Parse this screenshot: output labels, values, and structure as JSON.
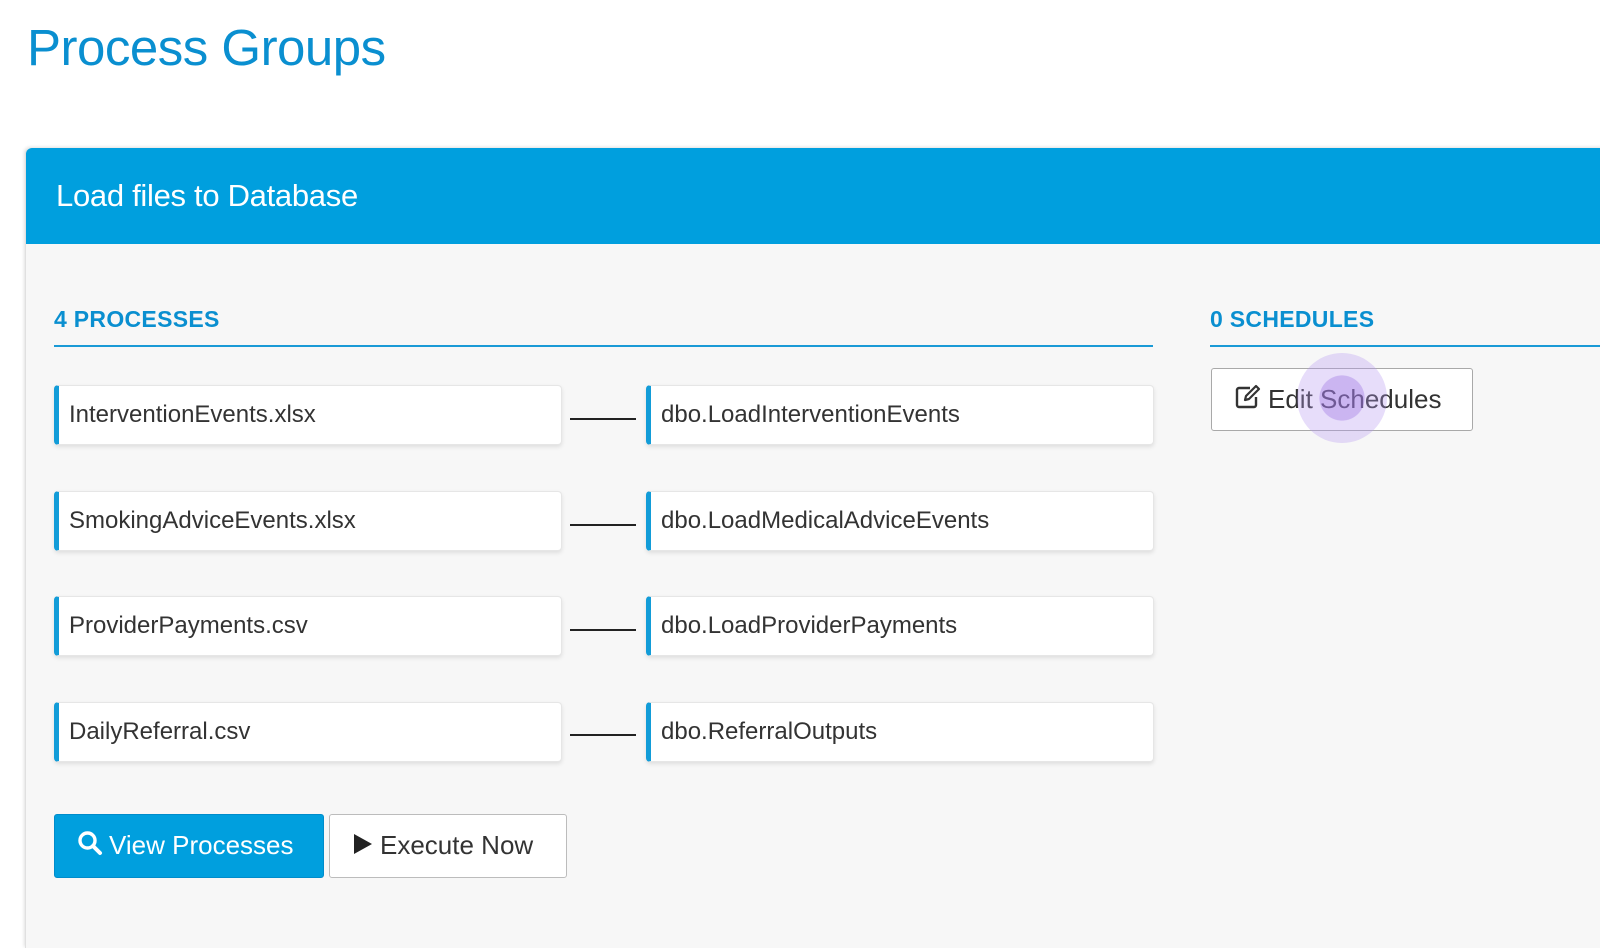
{
  "page": {
    "title": "Process Groups"
  },
  "panel": {
    "title": "Load files to Database",
    "processes_heading": "4 PROCESSES",
    "schedules_heading": "0 SCHEDULES",
    "processes": [
      {
        "source": "InterventionEvents.xlsx",
        "target": "dbo.LoadInterventionEvents"
      },
      {
        "source": "SmokingAdviceEvents.xlsx",
        "target": "dbo.LoadMedicalAdviceEvents"
      },
      {
        "source": "ProviderPayments.csv",
        "target": "dbo.LoadProviderPayments"
      },
      {
        "source": "DailyReferral.csv",
        "target": "dbo.ReferralOutputs"
      }
    ],
    "buttons": {
      "view_processes": "View Processes",
      "execute_now": "Execute Now",
      "edit_schedules": "Edit Schedules"
    }
  },
  "icons": {
    "view_processes": "search-icon",
    "execute_now": "play-icon",
    "edit_schedules": "edit-icon"
  },
  "colors": {
    "accent": "#009fde",
    "title": "#0a8fd0"
  }
}
